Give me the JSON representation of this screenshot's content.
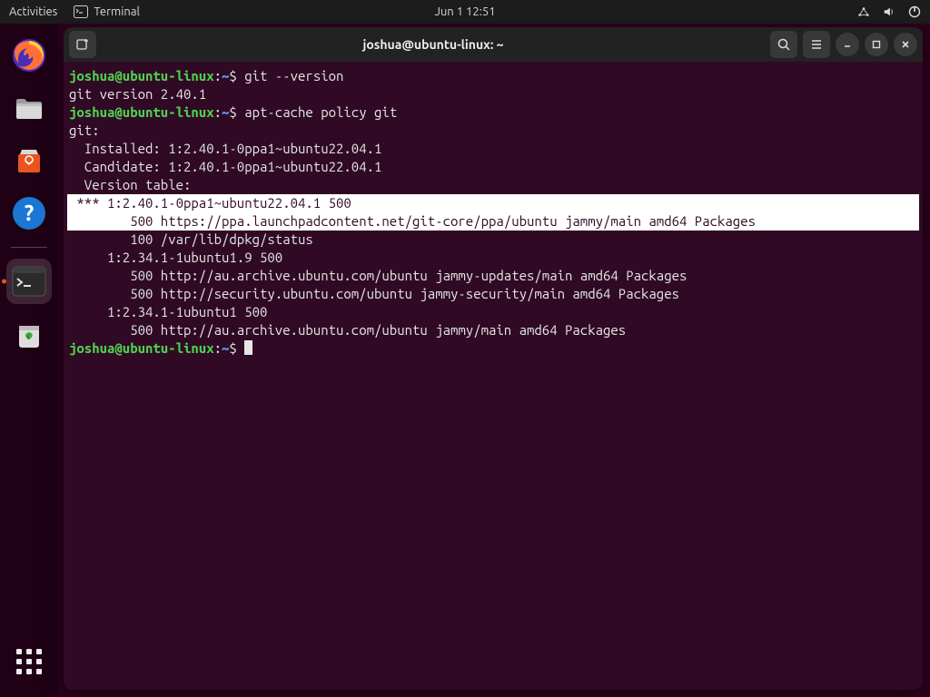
{
  "topbar": {
    "activities": "Activities",
    "app_name": "Terminal",
    "datetime": "Jun 1  12:51"
  },
  "window": {
    "title": "joshua@ubuntu-linux: ~"
  },
  "prompt": {
    "user_host": "joshua@ubuntu-linux",
    "sep": ":",
    "path": "~",
    "symbol": "$"
  },
  "terminal": {
    "cmd1": "git --version",
    "out1": "git version 2.40.1",
    "cmd2": "apt-cache policy git",
    "out2_l1": "git:",
    "out2_l2": "  Installed: 1:2.40.1-0ppa1~ubuntu22.04.1",
    "out2_l3": "  Candidate: 1:2.40.1-0ppa1~ubuntu22.04.1",
    "out2_l4": "  Version table:",
    "out2_l5": " *** 1:2.40.1-0ppa1~ubuntu22.04.1 500",
    "out2_l6": "        500 https://ppa.launchpadcontent.net/git-core/ppa/ubuntu jammy/main amd64 Packages",
    "out2_l7": "        100 /var/lib/dpkg/status",
    "out2_l8": "     1:2.34.1-1ubuntu1.9 500",
    "out2_l9": "        500 http://au.archive.ubuntu.com/ubuntu jammy-updates/main amd64 Packages",
    "out2_l10": "        500 http://security.ubuntu.com/ubuntu jammy-security/main amd64 Packages",
    "out2_l11": "     1:2.34.1-1ubuntu1 500",
    "out2_l12": "        500 http://au.archive.ubuntu.com/ubuntu jammy/main amd64 Packages"
  }
}
